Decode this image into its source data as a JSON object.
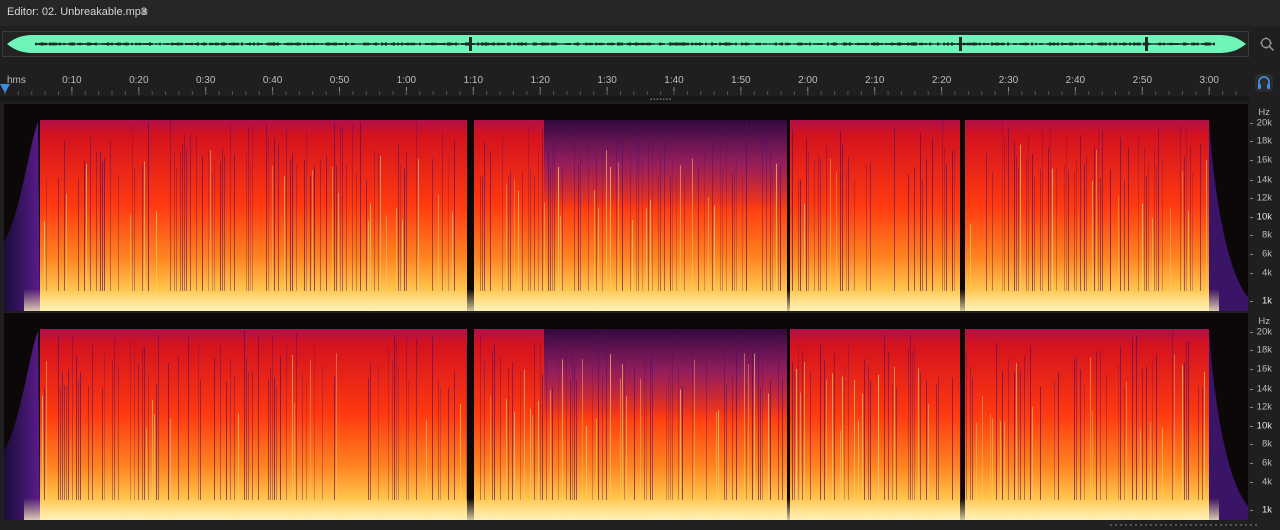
{
  "editor": {
    "title": "Editor: 02. Unbreakable.mp3",
    "menu_icon": "hamburger-menu-icon"
  },
  "overview": {
    "waveform_color": "#6ef5b7",
    "zoom_icon": "zoom-navigator-icon"
  },
  "ruler": {
    "unit_label": "hms",
    "ticks": [
      "0:10",
      "0:20",
      "0:30",
      "0:40",
      "0:50",
      "1:00",
      "1:10",
      "1:20",
      "1:30",
      "1:40",
      "1:50",
      "2:00",
      "2:10",
      "2:20",
      "2:30",
      "2:40",
      "2:50",
      "3:00"
    ],
    "playhead_color": "#3d8de0"
  },
  "headphones": {
    "icon": "headphones-icon"
  },
  "spectral": {
    "unit": "Hz",
    "labels": [
      "20k",
      "18k",
      "16k",
      "14k",
      "12k",
      "10k",
      "8k",
      "6k",
      "4k",
      "1k"
    ],
    "channels": [
      "left",
      "right"
    ],
    "colors": {
      "low": "#ffe28a",
      "mid": "#ff4a14",
      "high": "#5a1c8c",
      "silence": "#0d0808"
    }
  }
}
